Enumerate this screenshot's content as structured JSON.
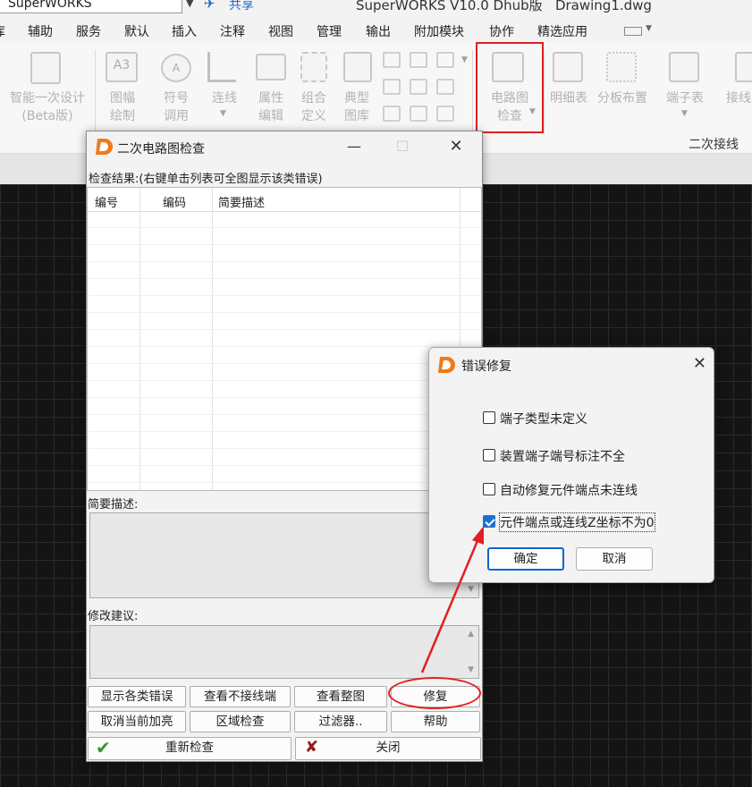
{
  "titlebar": {
    "workspace_value": "SuperWORKS",
    "share_label": "共享",
    "app_title": "SuperWORKS V10.0 Dhub版   Drawing1.dwg"
  },
  "menu": [
    "库",
    "辅助",
    "服务",
    "默认",
    "插入",
    "注释",
    "视图",
    "管理",
    "输出",
    "附加模块",
    "协作",
    "精选应用"
  ],
  "ribbon": {
    "group_label": "二次接线",
    "tools": {
      "smart_design": [
        "智能一次设计",
        "(Beta版)"
      ],
      "frame_draw": [
        "图幅",
        "绘制"
      ],
      "symbol_call": [
        "符号",
        "调用"
      ],
      "wiring": [
        "连线"
      ],
      "attr_edit": [
        "属性",
        "编辑"
      ],
      "combo_def": [
        "组合",
        "定义"
      ],
      "typical_lib": [
        "典型",
        "图库"
      ],
      "circuit_check": [
        "电路图",
        "检查"
      ],
      "detail_table": [
        "明细表"
      ],
      "board_layout": [
        "分板布置"
      ],
      "terminal_table": [
        "端子表"
      ],
      "connect": [
        "接线"
      ]
    }
  },
  "check_dialog": {
    "title": "二次电路图检查",
    "result_label": "检查结果:(右键单击列表可全图显示该类错误)",
    "columns": [
      "编号",
      "编码",
      "简要描述"
    ],
    "summary_label": "简要描述:",
    "suggest_label": "修改建议:",
    "buttons": {
      "show_errors": "显示各类错误",
      "view_unconnected": "查看不接线端",
      "view_full": "查看整图",
      "repair": "修复",
      "cancel_highlight": "取消当前加亮",
      "area_check": "区域检查",
      "filter": "过滤器..",
      "help": "帮助",
      "recheck": "重新检查",
      "close": "关闭"
    }
  },
  "fix_dialog": {
    "title": "错误修复",
    "options": [
      {
        "label": "端子类型未定义",
        "checked": false
      },
      {
        "label": "装置端子端号标注不全",
        "checked": false
      },
      {
        "label": "自动修复元件端点未连线",
        "checked": false
      },
      {
        "label": "元件端点或连线Z坐标不为0",
        "checked": true
      }
    ],
    "ok": "确定",
    "cancel": "取消"
  },
  "colors": {
    "annotation_red": "#e02020",
    "accent_blue": "#1f6fd3",
    "logo_orange": "#f07a1a",
    "canvas_bg": "#141414"
  }
}
